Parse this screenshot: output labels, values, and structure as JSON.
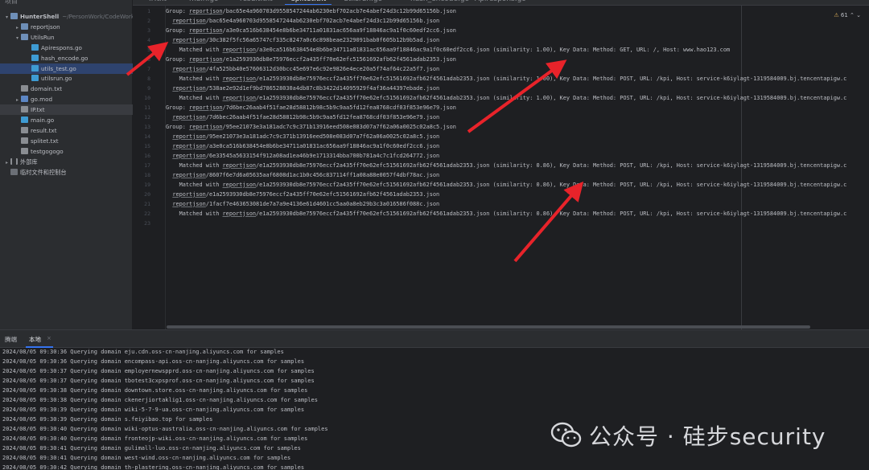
{
  "tabs": [
    {
      "label": "IP.txt",
      "active": false
    },
    {
      "label": "main.go",
      "active": false
    },
    {
      "label": "result.txt",
      "active": false
    },
    {
      "label": "splitet.txt",
      "active": true
    },
    {
      "label": "utilsrun.go",
      "active": false
    },
    {
      "label": "hash_encode.go",
      "active": false
    },
    {
      "label": "Apirespons.go",
      "active": false
    }
  ],
  "sidebar": {
    "header": "项目",
    "items": [
      {
        "label": "HunterShell",
        "extra": "~/PersonWork/CodeWork/G",
        "icon": "folder",
        "depth": 0,
        "chevron": "▾"
      },
      {
        "label": "reportjson",
        "icon": "folder",
        "depth": 1,
        "chevron": "▸"
      },
      {
        "label": "UtilsRun",
        "icon": "folder",
        "depth": 1,
        "chevron": "▾"
      },
      {
        "label": "Apirespons.go",
        "icon": "go",
        "depth": 2,
        "chevron": ""
      },
      {
        "label": "hash_encode.go",
        "icon": "go",
        "depth": 2,
        "chevron": ""
      },
      {
        "label": "utils_test.go",
        "icon": "go",
        "depth": 2,
        "chevron": "",
        "selected": true
      },
      {
        "label": "utilsrun.go",
        "icon": "go",
        "depth": 2,
        "chevron": ""
      },
      {
        "label": "domain.txt",
        "icon": "txt",
        "depth": 1,
        "chevron": ""
      },
      {
        "label": "go.mod",
        "icon": "gomod",
        "depth": 1,
        "chevron": "▸"
      },
      {
        "label": "IP.txt",
        "icon": "txt",
        "depth": 1,
        "chevron": "",
        "highlight": true
      },
      {
        "label": "main.go",
        "icon": "go",
        "depth": 1,
        "chevron": ""
      },
      {
        "label": "result.txt",
        "icon": "txt",
        "depth": 1,
        "chevron": ""
      },
      {
        "label": "splitet.txt",
        "icon": "txt",
        "depth": 1,
        "chevron": ""
      },
      {
        "label": "testgogogo",
        "icon": "txt",
        "depth": 1,
        "chevron": ""
      },
      {
        "label": "外部库",
        "icon": "bars",
        "depth": 0,
        "chevron": "▸"
      },
      {
        "label": "临时文件和控制台",
        "icon": "term",
        "depth": 0,
        "chevron": ""
      }
    ]
  },
  "editor": {
    "warnings": "61",
    "lines": [
      "Group: reportjson/bac65e4a960703d9558547244ab6230ebf702acb7e4abef24d3c12b99d65156b.json",
      "  reportjson/bac65e4a960703d9558547244ab6230ebf702acb7e4abef24d3c12b99d65156b.json",
      "Group: reportjson/a3e0ca516b638454e8b6be34711a01831ac656aa9f18846ac9a1f0c60edf2cc6.json",
      "  reportjson/30c382f5fc56a65747cf335c8247a0c6c898beae2329091bab0f605b12b9b5ad.json",
      "    Matched with reportjson/a3e0ca516b638454e8b6be34711a01831ac656aa9f18846ac9a1f0c60edf2cc6.json (similarity: 1.00), Key Data: Method: GET, URL: /, Host: www.hao123.com",
      "Group: reportjson/e1a2593930db8e75976eccf2a435ff70e62efc51561692afb62f4561adab2353.json",
      "  reportjson/4fa525bb40e57606312d30bcc45e697e6c92e9826e4ece20a5f74af64c22a5f7.json",
      "    Matched with reportjson/e1a2593930db8e75976eccf2a435ff70e62efc51561692afb62f4561adab2353.json (similarity: 1.00), Key Data: Method: POST, URL: /kpi, Host: service-k6iylagt-1319584009.bj.tencentapigw.c",
      "  reportjson/538ae2e92d1ef9bd786528030a4db87c8b3422d14095929f4af36a44397ebade.json",
      "    Matched with reportjson/e1a2593930db8e75976eccf2a435ff70e62efc51561692afb62f4561adab2353.json (similarity: 1.00), Key Data: Method: POST, URL: /kpi, Host: service-k6iylagt-1319584009.bj.tencentapigw.c",
      "Group: reportjson/7d6bec26aab4f51fae28d58812b98c5b9c9aa5fd12fea8768cdf03f853e96e79.json",
      "  reportjson/7d6bec26aab4f51fae28d58812b98c5b9c9aa5fd12fea8768cdf03f853e96e79.json",
      "Group: reportjson/95ee21073e3a181adc7c9c371b13916eed508e083d07a7f62a06a0025c02a8c5.json",
      "  reportjson/95ee21073e3a181adc7c9c371b13916eed508e083d07a7f62a06a0025c02a8c5.json",
      "  reportjson/a3e0ca516b638454e8b6be34711a01831ac656aa9f18846ac9a1f0c60edf2cc6.json",
      "  reportjson/6e33545a5633154f912a08ad1ea46b9e1713314bba700b781a4c7c1fcd264772.json",
      "    Matched with reportjson/e1a2593930db8e75976eccf2a435ff70e62efc51561692afb62f4561adab2353.json (similarity: 0.86), Key Data: Method: POST, URL: /kpi, Host: service-k6iylagt-1319584009.bj.tencentapigw.c",
      "  reportjson/8607f6e7d6a05635aaf6808d1ac1b0c456c837114ff1a08a88e0057f4dbf78ac.json",
      "    Matched with reportjson/e1a2593930db8e75976eccf2a435ff70e62efc51561692afb62f4561adab2353.json (similarity: 0.86), Key Data: Method: POST, URL: /kpi, Host: service-k6iylagt-1319584009.bj.tencentapigw.c",
      "  reportjson/e1a2593930db8e75976eccf2a435ff70e62efc51561692afb62f4561adab2353.json",
      "  reportjson/1facf7e463653081de7a7a9e4136e61d4601cc5aa0a8eb29b3c3a016586f088c.json",
      "    Matched with reportjson/e1a2593930db8e75976eccf2a435ff70e62efc51561692afb62f4561adab2353.json (similarity: 0.86), Key Data: Method: POST, URL: /kpi, Host: service-k6iylagt-1319584009.bj.tencentapigw.c",
      ""
    ]
  },
  "panel": {
    "tabs": [
      {
        "label": "腾端",
        "active": false
      },
      {
        "label": "本地",
        "active": true
      }
    ],
    "log": [
      "2024/08/05 09:30:36 Querying domain eju.cdn.oss-cn-nanjing.aliyuncs.com for samples",
      "2024/08/05 09:30:36 Querying domain encompass-api.oss-cn-nanjing.aliyuncs.com for samples",
      "2024/08/05 09:30:37 Querying domain employernewspprd.oss-cn-nanjing.aliyuncs.com for samples",
      "2024/08/05 09:30:37 Querying domain tbotest3cxpsprof.oss-cn-nanjing.aliyuncs.com for samples",
      "2024/08/05 09:30:38 Querying domain downtown.store.oss-cn-nanjing.aliyuncs.com for samples",
      "2024/08/05 09:30:38 Querying domain ckenerjiortaklig1.oss-cn-nanjing.aliyuncs.com for samples",
      "2024/08/05 09:30:39 Querying domain wiki-5-7-9-ua.oss-cn-nanjing.aliyuncs.com for samples",
      "2024/08/05 09:30:39 Querying domain s.feiyibao.top for samples",
      "2024/08/05 09:30:40 Querying domain wiki-optus-australia.oss-cn-nanjing.aliyuncs.com for samples",
      "2024/08/05 09:30:40 Querying domain fronteojp-wiki.oss-cn-nanjing.aliyuncs.com for samples",
      "2024/08/05 09:30:41 Querying domain gulimall-luo.oss-cn-nanjing.aliyuncs.com for samples",
      "2024/08/05 09:30:41 Querying domain west-wind.oss-cn-nanjing.aliyuncs.com for samples",
      "2024/08/05 09:30:42 Querying domain th-plastering.oss-cn-nanjing.aliyuncs.com for samples"
    ]
  },
  "watermark": {
    "text": "公众号 · 硅步security"
  },
  "colors": {
    "arrow": "#e8232a",
    "accent": "#3574f0",
    "selection": "#2e436e"
  }
}
